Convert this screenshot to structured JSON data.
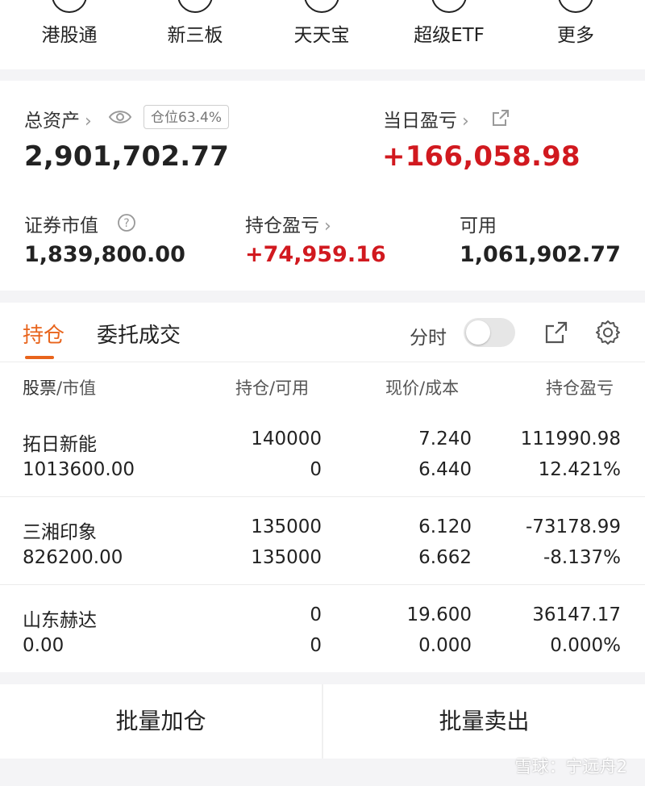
{
  "topnav": {
    "items": [
      {
        "label": "港股通"
      },
      {
        "label": "新三板"
      },
      {
        "label": "天天宝"
      },
      {
        "label": "超级ETF"
      },
      {
        "label": "更多"
      }
    ]
  },
  "assets": {
    "total_label": "总资产",
    "position_ratio": "仓位63.4%",
    "total_value": "2,901,702.77",
    "daily_pnl_label": "当日盈亏",
    "daily_pnl_value": "+166,058.98",
    "market_value_label": "证券市值",
    "market_value": "1,839,800.00",
    "holding_pnl_label": "持仓盈亏",
    "holding_pnl_value": "+74,959.16",
    "available_label": "可用",
    "available_value": "1,061,902.77"
  },
  "holdings": {
    "tabs": [
      {
        "label": "持仓",
        "active": true
      },
      {
        "label": "委托成交",
        "active": false
      }
    ],
    "intraday_label": "分时",
    "intraday_on": false,
    "columns": {
      "stock": "股票",
      "market_value": "市值",
      "position": "持仓",
      "available": "可用",
      "price": "现价",
      "cost": "成本",
      "pnl": "持仓盈亏"
    },
    "rows": [
      {
        "name": "拓日新能",
        "market_value": "1013600.00",
        "position": "140000",
        "available": "0",
        "price": "7.240",
        "cost": "6.440",
        "pnl": "111990.98",
        "pnl_pct": "12.421%",
        "trend": "up"
      },
      {
        "name": "三湘印象",
        "market_value": "826200.00",
        "position": "135000",
        "available": "135000",
        "price": "6.120",
        "cost": "6.662",
        "pnl": "-73178.99",
        "pnl_pct": "-8.137%",
        "trend": "down"
      },
      {
        "name": "山东赫达",
        "market_value": "0.00",
        "position": "0",
        "available": "0",
        "price": "19.600",
        "cost": "0.000",
        "pnl": "36147.17",
        "pnl_pct": "0.000%",
        "trend": "up"
      }
    ]
  },
  "actions": {
    "batch_add": "批量加仓",
    "batch_sell": "批量卖出"
  },
  "watermark": "雪球：宁远舟2",
  "colors": {
    "up": "#d1191f",
    "down": "#2f9a2a",
    "accent": "#e8641c"
  }
}
